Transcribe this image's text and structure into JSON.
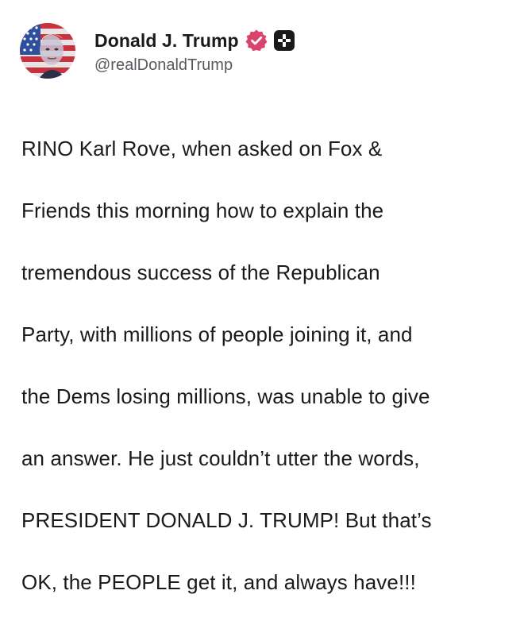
{
  "post": {
    "author": {
      "display_name": "Donald J. Trump",
      "handle": "@realDonaldTrump",
      "verified_icon": "verified-badge-icon",
      "plus_icon": "plus-badge-icon",
      "avatar_icon": "avatar-photo"
    },
    "text_lines": [
      "RINO Karl Rove, when asked on Fox &",
      "Friends this morning how to explain the",
      "tremendous success of the Republican",
      "Party, with millions of people joining it, and",
      "the Dems losing millions, was unable to give",
      "an answer. He just couldn’t utter the words,",
      "PRESIDENT DONALD J. TRUMP! But that’s",
      "OK, the PEOPLE get it, and always have!!!"
    ]
  },
  "colors": {
    "verified": "#d9446b",
    "plus_badge": "#1a1a1a",
    "text": "#1a1a1a",
    "handle": "#555a60"
  }
}
